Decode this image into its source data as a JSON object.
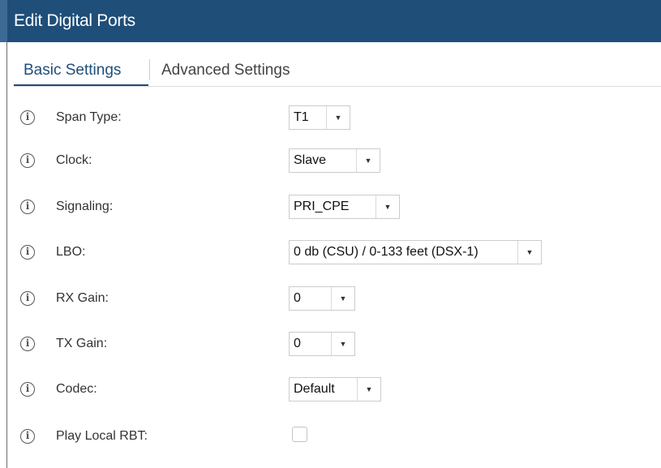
{
  "dialog": {
    "title": "Edit Digital Ports"
  },
  "tabs": [
    {
      "label": "Basic Settings",
      "active": true
    },
    {
      "label": "Advanced Settings",
      "active": false
    }
  ],
  "icons": {
    "info": "info-icon",
    "dropdown": "chevron-down-icon"
  },
  "glyphs": {
    "info": "i",
    "arrow": "▼"
  },
  "colors": {
    "accent": "#1f4e79"
  },
  "fields": {
    "span_type": {
      "label": "Span Type:",
      "value": "T1"
    },
    "clock": {
      "label": "Clock:",
      "value": "Slave"
    },
    "signaling": {
      "label": "Signaling:",
      "value": "PRI_CPE"
    },
    "lbo": {
      "label": "LBO:",
      "value": "0 db (CSU) / 0-133 feet (DSX-1)"
    },
    "rx_gain": {
      "label": "RX Gain:",
      "value": "0"
    },
    "tx_gain": {
      "label": "TX Gain:",
      "value": "0"
    },
    "codec": {
      "label": "Codec:",
      "value": "Default"
    },
    "play_local_rbt": {
      "label": "Play Local RBT:",
      "checked": false
    }
  }
}
